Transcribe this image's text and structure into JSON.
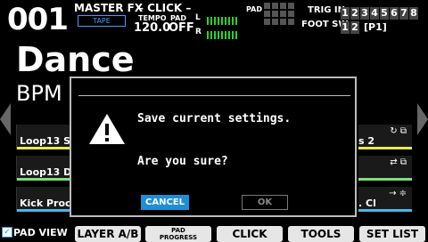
{
  "kit": {
    "number": "001",
    "name": "Dance",
    "bpm_label": "BPM"
  },
  "header": {
    "master_fx_label": "MASTER FX",
    "master_fx_value": "TAPE",
    "click_label": "– CLICK –",
    "tempo_label": "TEMPO",
    "tempo_value": "120.0",
    "pad_label": "PAD",
    "pad_value": "OFF",
    "meter_l_label": "L",
    "meter_r_label": "R",
    "pad_grid_label": "PAD",
    "trig_in_label": "TRIG IN",
    "trig_in_values": [
      "1",
      "2",
      "3",
      "4",
      "5",
      "6",
      "7",
      "8"
    ],
    "foot_sw_label": "FOOT SW",
    "foot_sw_values": [
      "1",
      "2"
    ],
    "foot_sw_bank": "[P1]"
  },
  "loops_left": [
    {
      "label": "Loop13 S",
      "bar_color": "#e8e84a"
    },
    {
      "label": "Loop13 D",
      "bar_color": "#7be07b"
    },
    {
      "label": "Kick Proc",
      "bar_color": "#4ab8e8"
    }
  ],
  "loops_right": [
    {
      "label": "s 2",
      "icon": "↻ ⧉",
      "bar_color": "#e8e84a"
    },
    {
      "label": "",
      "icon": "⇄ ⧉",
      "bar_color": "#7be07b"
    },
    {
      "label": ". Cl",
      "icon": "→ ≑",
      "bar_color": "#4ab8e8"
    }
  ],
  "dialog": {
    "line1": "Save current settings.",
    "line2": "Are you sure?",
    "cancel_label": "CANCEL",
    "ok_label": "OK"
  },
  "footer": {
    "pad_view_label": "PAD VIEW",
    "layer_label": "LAYER A/B",
    "pad_progress_label_1": "PAD",
    "pad_progress_label_2": "PROGRESS",
    "click_label": "CLICK",
    "tools_label": "TOOLS",
    "set_list_label": "SET LIST"
  }
}
